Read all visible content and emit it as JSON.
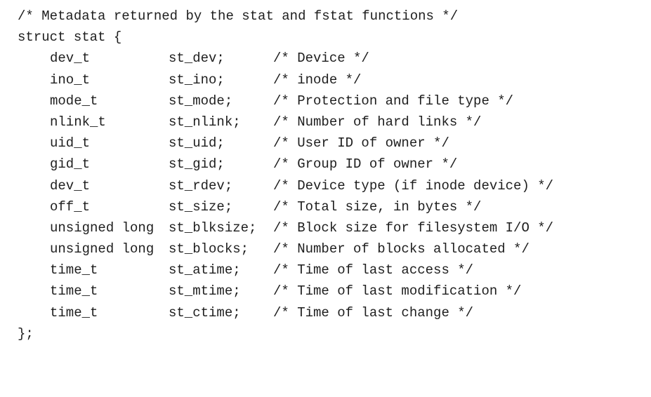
{
  "code": {
    "header_comment": "/* Metadata returned by the stat and fstat functions */",
    "struct_open": "struct stat {",
    "fields": [
      {
        "type": "dev_t",
        "name": "st_dev;",
        "comment": "/* Device */"
      },
      {
        "type": "ino_t",
        "name": "st_ino;",
        "comment": "/* inode */"
      },
      {
        "type": "mode_t",
        "name": "st_mode;",
        "comment": "/* Protection and file type */"
      },
      {
        "type": "nlink_t",
        "name": "st_nlink;",
        "comment": "/* Number of hard links */"
      },
      {
        "type": "uid_t",
        "name": "st_uid;",
        "comment": "/* User ID of owner */"
      },
      {
        "type": "gid_t",
        "name": "st_gid;",
        "comment": "/* Group ID of owner */"
      },
      {
        "type": "dev_t",
        "name": "st_rdev;",
        "comment": "/* Device type (if inode device) */"
      },
      {
        "type": "off_t",
        "name": "st_size;",
        "comment": "/* Total size, in bytes */"
      },
      {
        "type": "unsigned long",
        "name": "st_blksize;",
        "comment": "/* Block size for filesystem I/O */"
      },
      {
        "type": "unsigned long",
        "name": "st_blocks;",
        "comment": "/* Number of blocks allocated */"
      },
      {
        "type": "time_t",
        "name": "st_atime;",
        "comment": "/* Time of last access */"
      },
      {
        "type": "time_t",
        "name": "st_mtime;",
        "comment": "/* Time of last modification */"
      },
      {
        "type": "time_t",
        "name": "st_ctime;",
        "comment": "/* Time of last change */"
      }
    ],
    "struct_close": "};"
  }
}
